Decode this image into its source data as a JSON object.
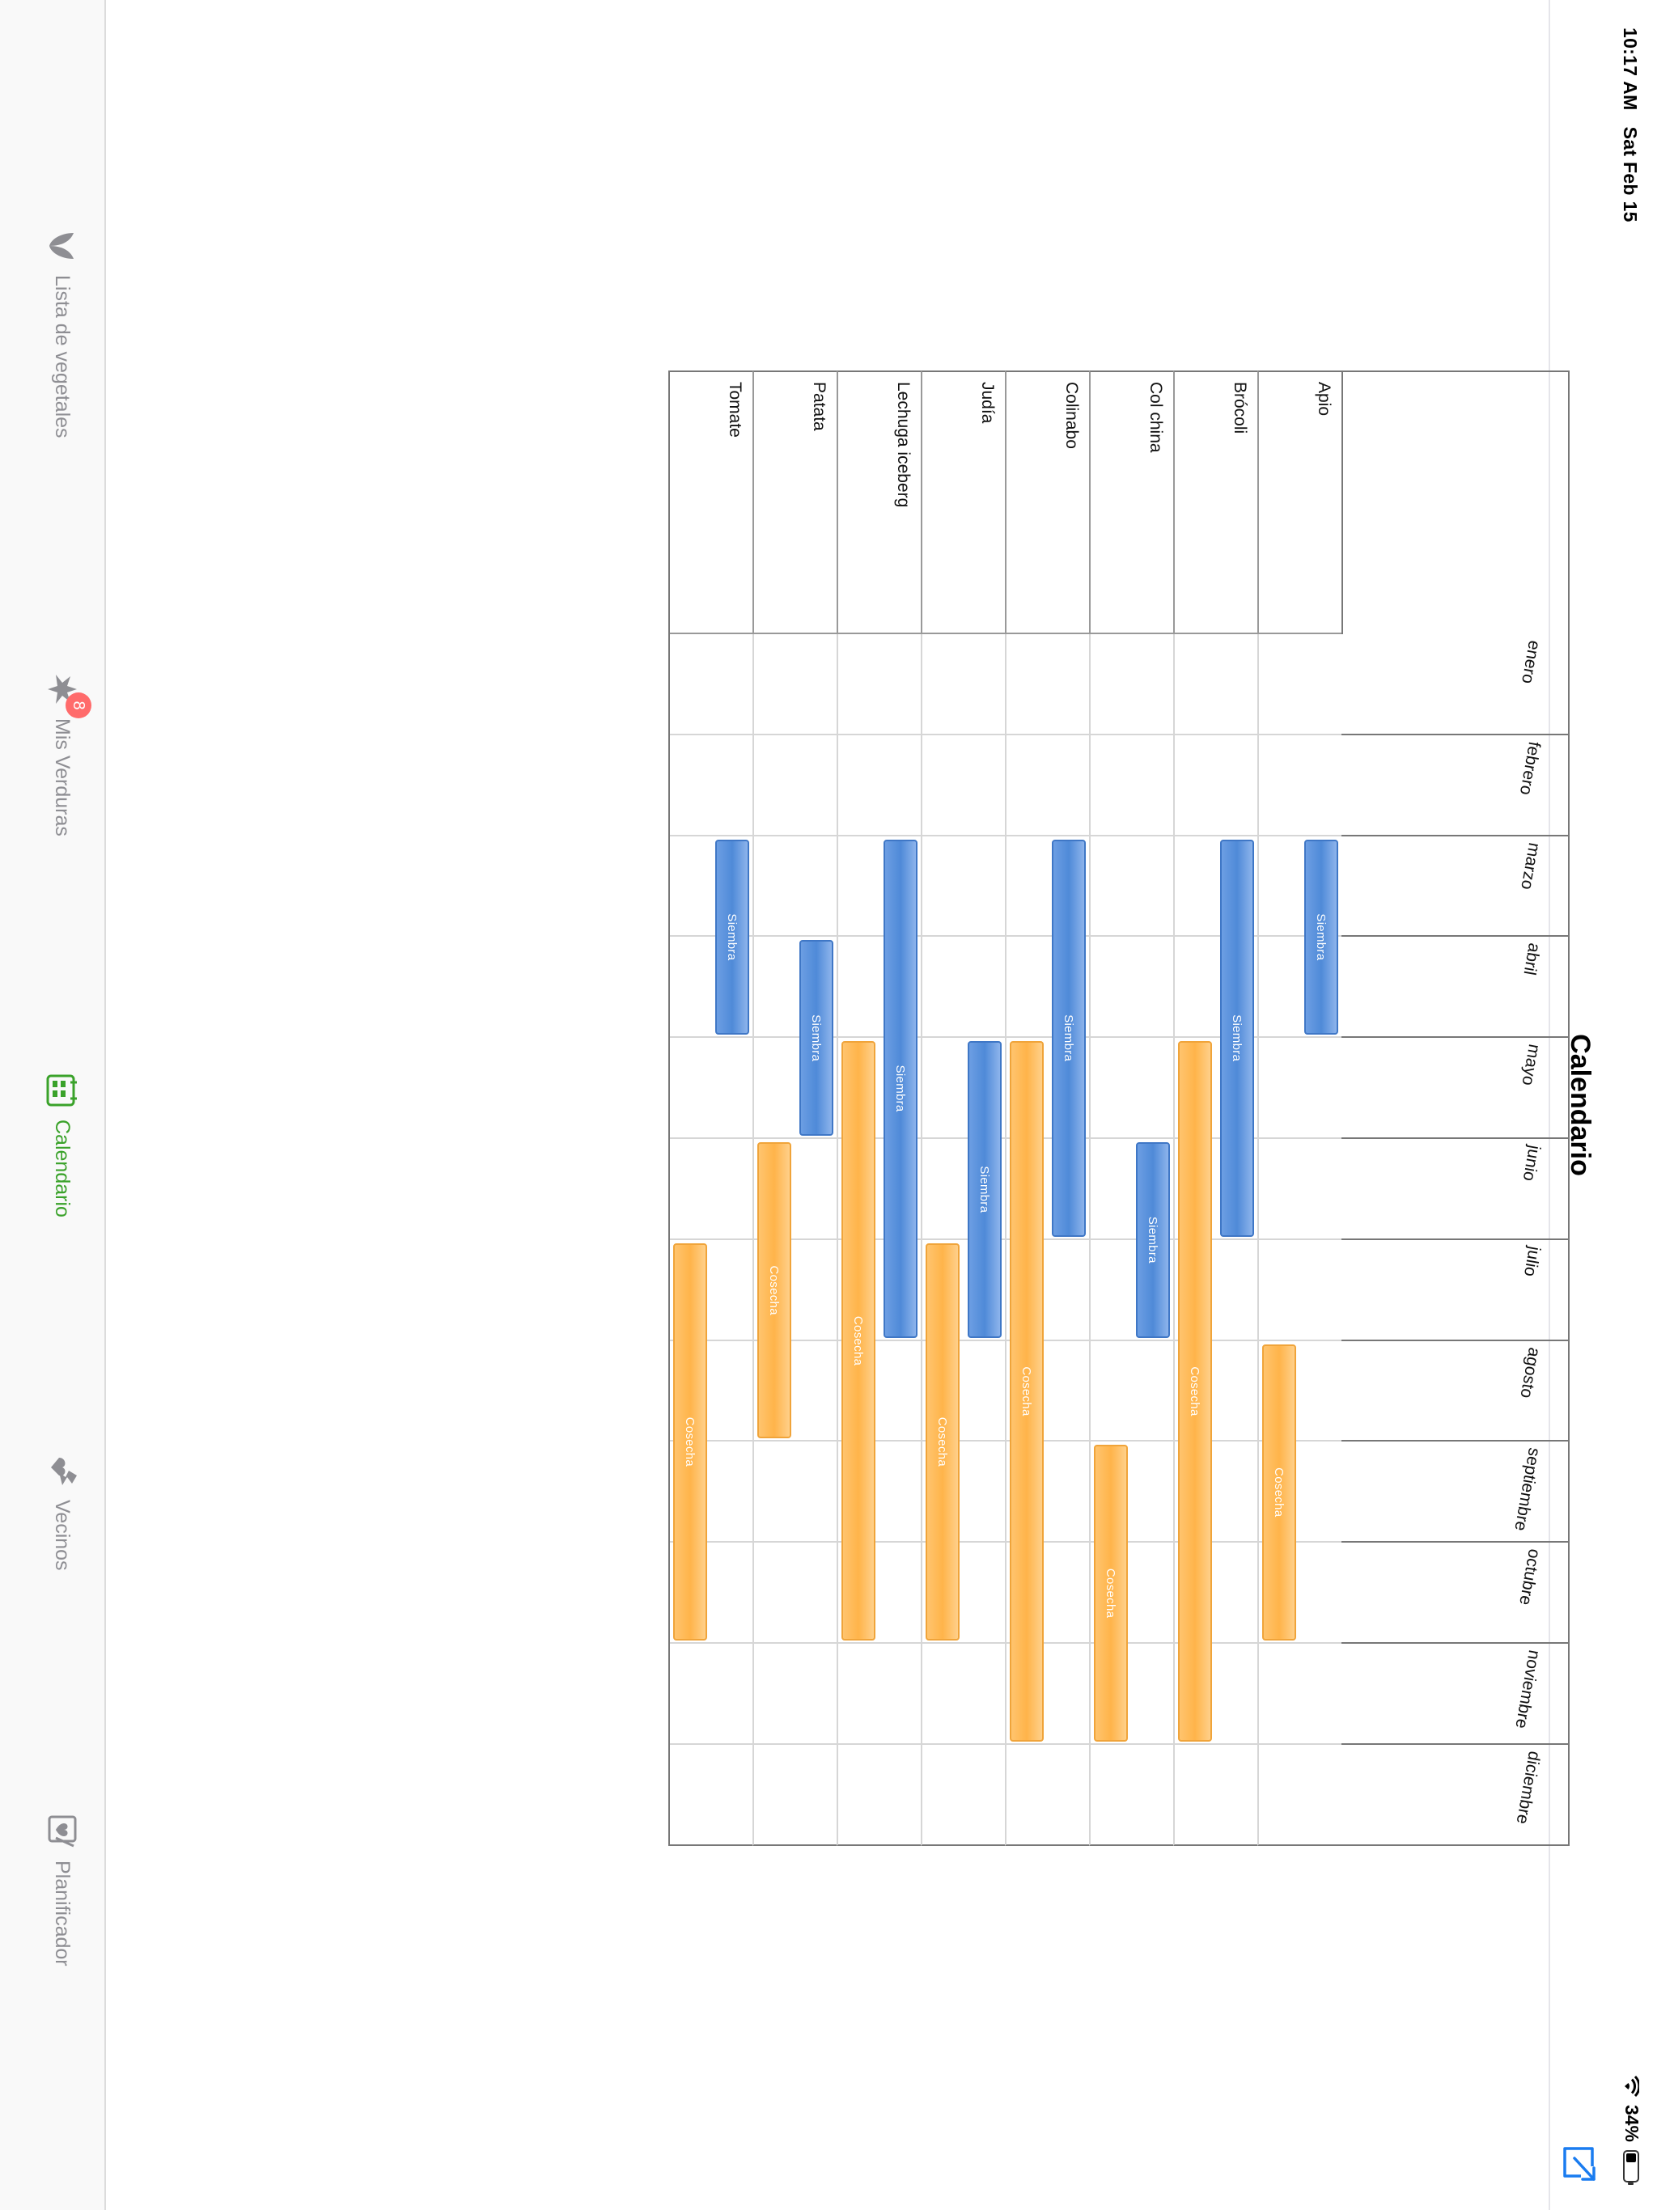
{
  "status_bar": {
    "time": "10:17 AM",
    "date": "Sat Feb 15",
    "battery": "34%",
    "battery_level": 0.34,
    "wifi_icon": "wifi-icon"
  },
  "nav": {
    "title": "Calendario",
    "share_icon": "share-icon"
  },
  "tabs": [
    {
      "label": "Lista de vegetales",
      "icon": "leaf-icon",
      "active": false
    },
    {
      "label": "Mis Verduras",
      "icon": "sprout-icon",
      "badge": "8",
      "active": false
    },
    {
      "label": "Calendario",
      "icon": "calendar-icon",
      "active": true
    },
    {
      "label": "Vecinos",
      "icon": "neighbors-icon",
      "active": false
    },
    {
      "label": "Planificador",
      "icon": "planner-icon",
      "active": false
    }
  ],
  "colors": {
    "accent": "#3aa22a",
    "siembra": "#4f8ad8",
    "cosecha": "#ffb44a",
    "badge": "#ff6b6b"
  },
  "calendar": {
    "months": [
      "enero",
      "febrero",
      "marzo",
      "abril",
      "mayo",
      "junio",
      "julio",
      "agosto",
      "septiembre",
      "octubre",
      "noviembre",
      "diciembre"
    ],
    "rows": [
      {
        "name": "Apio",
        "bars": [
          {
            "type": "Siembra",
            "start": 3.0,
            "end": 5.0,
            "lane": 0
          },
          {
            "type": "Cosecha",
            "start": 8.0,
            "end": 11.0,
            "lane": 1
          }
        ]
      },
      {
        "name": "Brócoli",
        "bars": [
          {
            "type": "Siembra",
            "start": 3.0,
            "end": 7.0,
            "lane": 0
          },
          {
            "type": "Cosecha",
            "start": 5.0,
            "end": 12.0,
            "lane": 1
          }
        ]
      },
      {
        "name": "Col china",
        "bars": [
          {
            "type": "Siembra",
            "start": 6.0,
            "end": 8.0,
            "lane": 0
          },
          {
            "type": "Cosecha",
            "start": 9.0,
            "end": 12.0,
            "lane": 1
          }
        ]
      },
      {
        "name": "Colinabo",
        "bars": [
          {
            "type": "Siembra",
            "start": 3.0,
            "end": 7.0,
            "lane": 0
          },
          {
            "type": "Cosecha",
            "start": 5.0,
            "end": 12.0,
            "lane": 1
          }
        ]
      },
      {
        "name": "Judía",
        "bars": [
          {
            "type": "Siembra",
            "start": 5.0,
            "end": 8.0,
            "lane": 0
          },
          {
            "type": "Cosecha",
            "start": 7.0,
            "end": 11.0,
            "lane": 1
          }
        ]
      },
      {
        "name": "Lechuga iceberg",
        "bars": [
          {
            "type": "Siembra",
            "start": 3.0,
            "end": 8.0,
            "lane": 0
          },
          {
            "type": "Cosecha",
            "start": 5.0,
            "end": 11.0,
            "lane": 1
          }
        ]
      },
      {
        "name": "Patata",
        "bars": [
          {
            "type": "Siembra",
            "start": 4.0,
            "end": 6.0,
            "lane": 0
          },
          {
            "type": "Cosecha",
            "start": 6.0,
            "end": 9.0,
            "lane": 1
          }
        ]
      },
      {
        "name": "Tomate",
        "bars": [
          {
            "type": "Siembra",
            "start": 3.0,
            "end": 5.0,
            "lane": 0
          },
          {
            "type": "Cosecha",
            "start": 7.0,
            "end": 11.0,
            "lane": 1
          }
        ]
      }
    ]
  }
}
